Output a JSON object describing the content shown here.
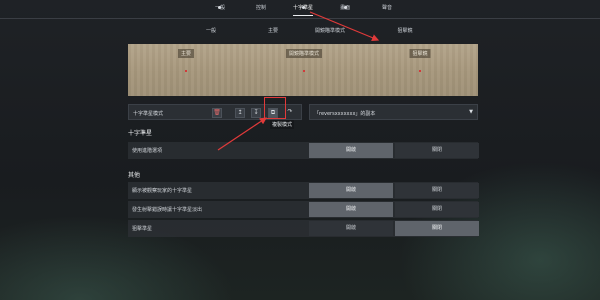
{
  "top_nav": {
    "items": [
      "一般",
      "控制",
      "十字準星",
      "畫面",
      "聲音"
    ],
    "active_index": 2
  },
  "sub_nav": [
    "一般",
    "主要",
    "開鏡瞄準模式",
    "狙擊鏡"
  ],
  "preview": {
    "labels": [
      "主要",
      "開鏡瞄準模式",
      "狙擊鏡"
    ]
  },
  "toolbar": {
    "profile_name": "十字準星模式",
    "buttons": {
      "delete_icon": "trash-icon",
      "upload_icon": "upload-icon",
      "download_icon": "download-icon",
      "copy_icon": "copy-icon",
      "import_icon": "import-icon"
    },
    "tooltip": "複製模式",
    "dropdown_value": "「reversxxxxxxx」的副本"
  },
  "sections": {
    "crosshair": {
      "title": "十字準星",
      "rows": [
        {
          "label": "使用進階選項",
          "options": [
            "開啟",
            "關閉"
          ],
          "selected": 1
        }
      ]
    },
    "other": {
      "title": "其他",
      "rows": [
        {
          "label": "顯示被觀察玩家的十字準星",
          "options": [
            "開啟",
            "關閉"
          ],
          "selected": 0
        },
        {
          "label": "發生射擊錯誤時讓十字準星淡出",
          "options": [
            "開啟",
            "關閉"
          ],
          "selected": 0
        },
        {
          "label": "狙擊準星",
          "options": [
            "開啟",
            "關閉"
          ],
          "selected": 1
        }
      ]
    }
  },
  "colors": {
    "highlight": "#e03a3a",
    "selected_option": "#5f646b",
    "preview_bg": "#a6977c"
  }
}
